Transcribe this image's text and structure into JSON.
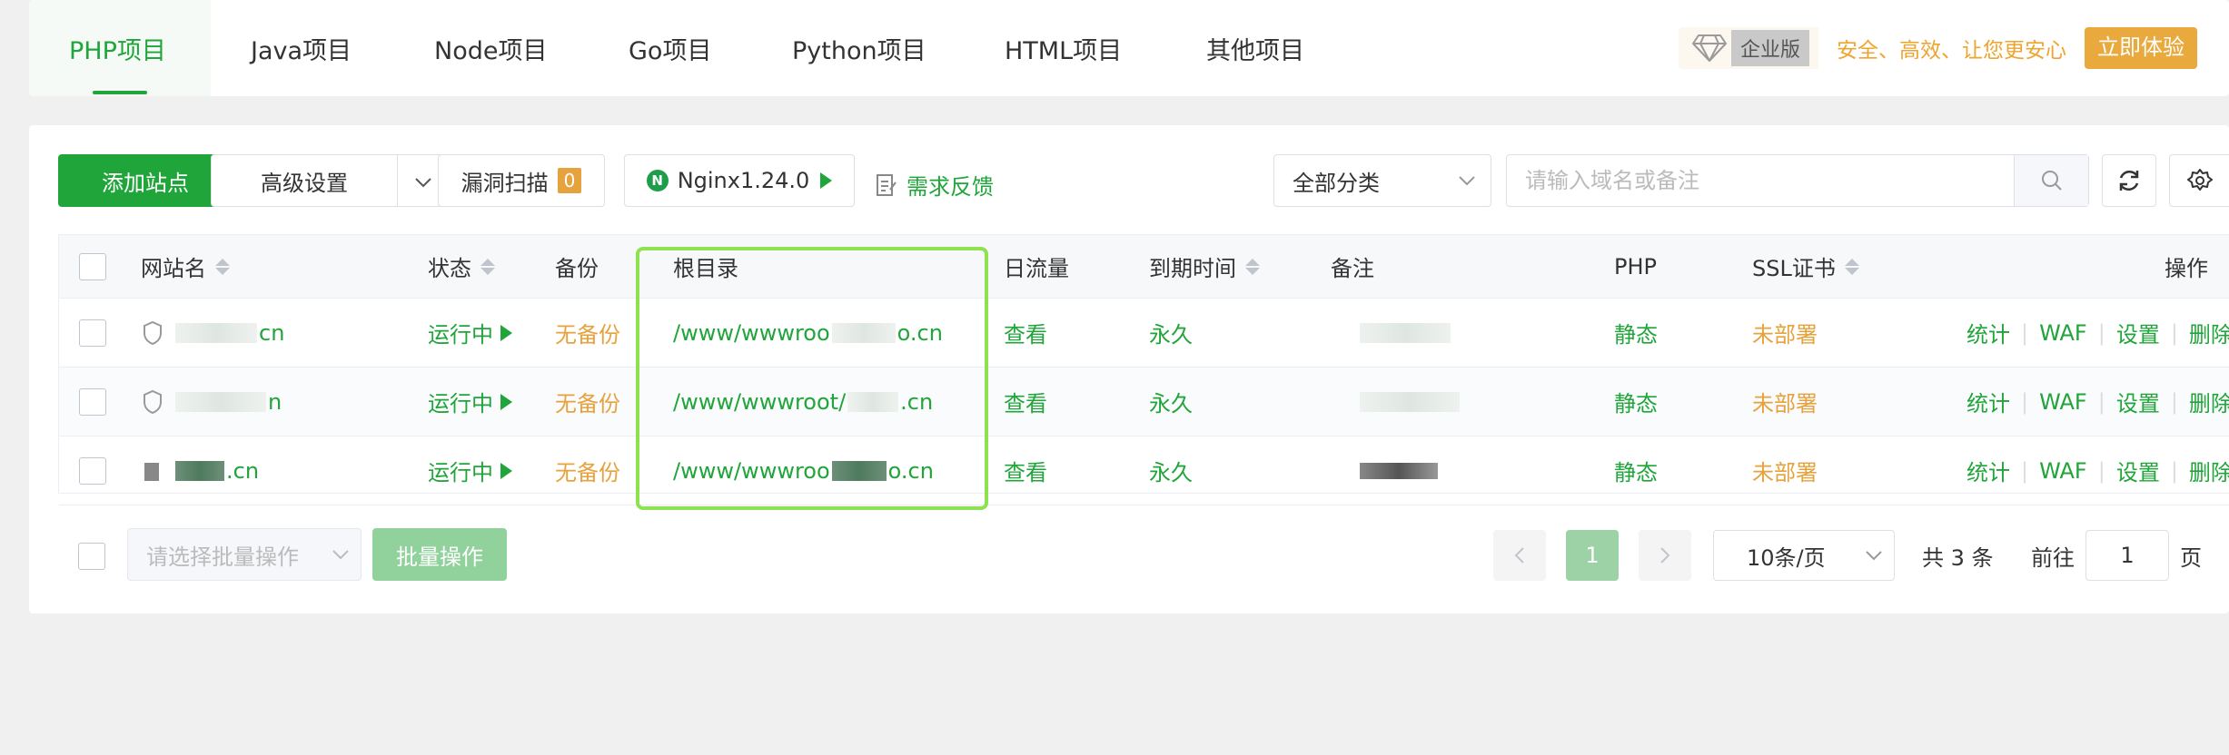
{
  "tabs": [
    {
      "label": "PHP项目",
      "active": true
    },
    {
      "label": "Java项目"
    },
    {
      "label": "Node项目"
    },
    {
      "label": "Go项目"
    },
    {
      "label": "Python项目"
    },
    {
      "label": "HTML项目"
    },
    {
      "label": "其他项目"
    }
  ],
  "enterprise": {
    "badge": "企业版",
    "slogan": "安全、高效、让您更安心",
    "cta": "立即体验"
  },
  "toolbar": {
    "add_site": "添加站点",
    "advanced": "高级设置",
    "vuln_scan": "漏洞扫描",
    "vuln_count": "0",
    "nginx": "Nginx1.24.0",
    "feedback": "需求反馈",
    "category": "全部分类",
    "search_placeholder": "请输入域名或备注"
  },
  "table": {
    "headers": {
      "site": "网站名",
      "status": "状态",
      "backup": "备份",
      "root": "根目录",
      "traffic": "日流量",
      "expire": "到期时间",
      "remark": "备注",
      "php": "PHP",
      "ssl": "SSL证书",
      "ops": "操作"
    },
    "rows": [
      {
        "site_suffix": "cn",
        "status": "运行中",
        "backup": "无备份",
        "root_prefix": "/www/wwwroo",
        "root_suffix": "o.cn",
        "traffic": "查看",
        "expire": "永久",
        "php": "静态",
        "ssl": "未部署"
      },
      {
        "site_suffix": "n",
        "status": "运行中",
        "backup": "无备份",
        "root_prefix": "/www/wwwroot/",
        "root_suffix": ".cn",
        "traffic": "查看",
        "expire": "永久",
        "php": "静态",
        "ssl": "未部署"
      },
      {
        "site_suffix": ".cn",
        "status": "运行中",
        "backup": "无备份",
        "root_prefix": "/www/wwwroo",
        "root_suffix": "o.cn",
        "traffic": "查看",
        "expire": "永久",
        "php": "静态",
        "ssl": "未部署"
      }
    ],
    "ops": [
      "统计",
      "WAF",
      "设置",
      "删除"
    ]
  },
  "footer": {
    "batch_placeholder": "请选择批量操作",
    "batch_button": "批量操作",
    "current_page": "1",
    "page_size": "10条/页",
    "total": "共 3 条",
    "goto_label": "前往",
    "goto_value": "1",
    "page_unit": "页"
  },
  "colors": {
    "primary": "#20a53a",
    "warning": "#e6a23c",
    "highlight_box": "#8fe24f"
  }
}
